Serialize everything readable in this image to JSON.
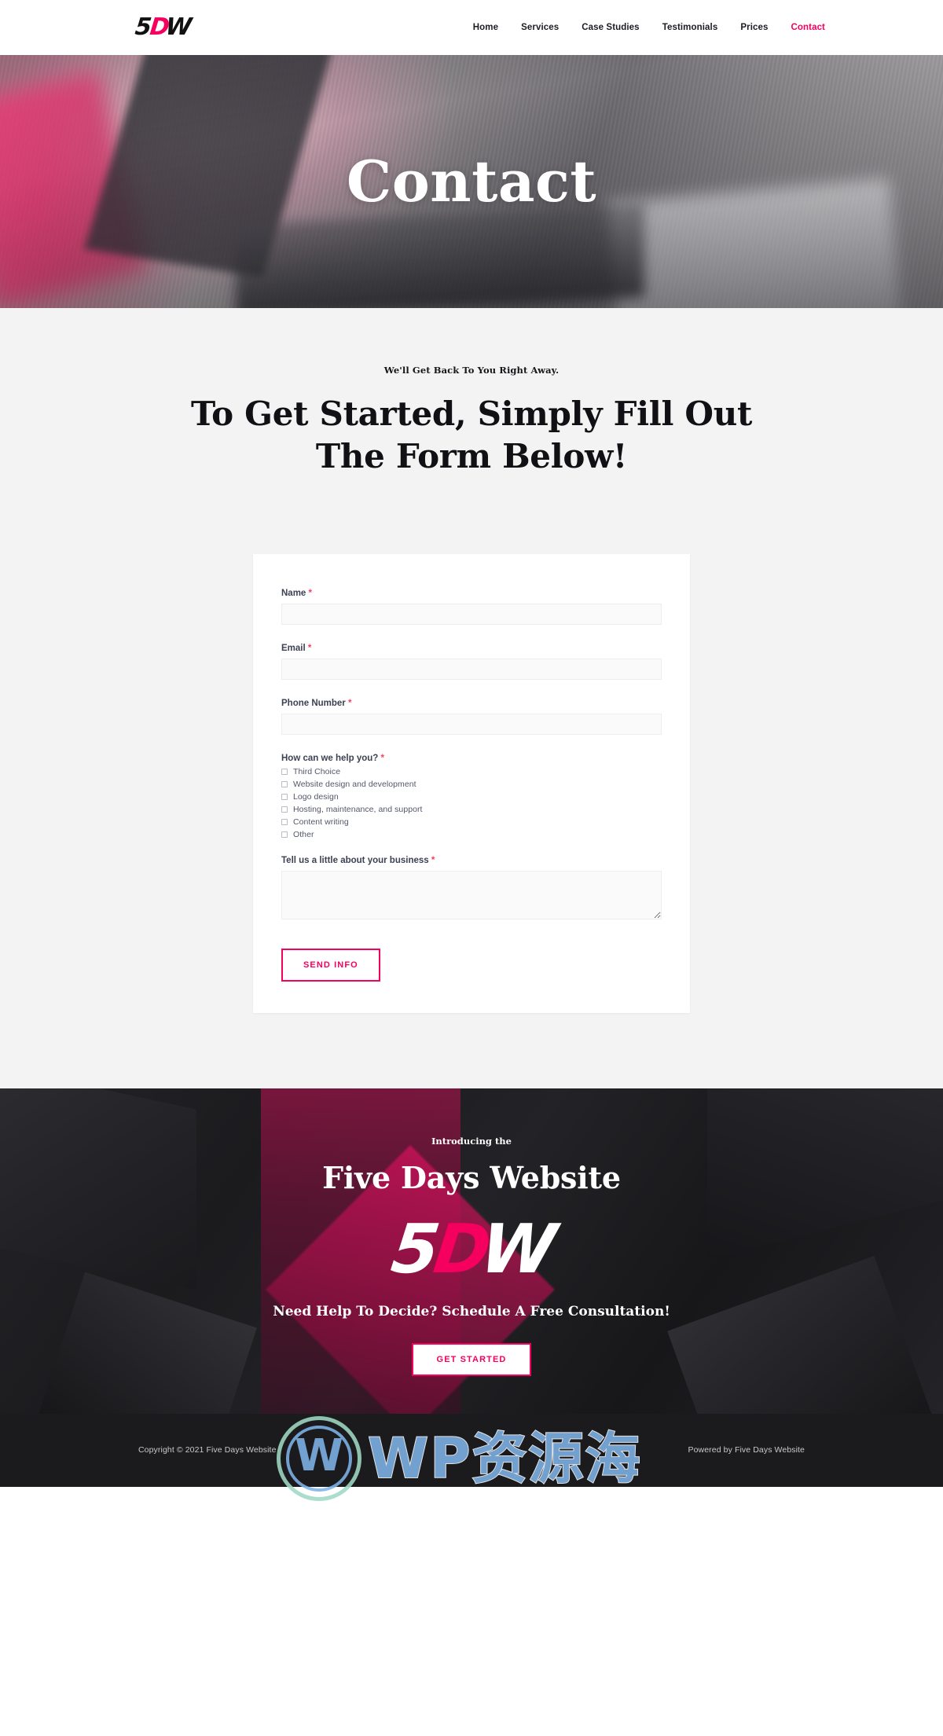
{
  "header": {
    "logo": {
      "part1": "5",
      "part2": "D",
      "part3": "W"
    },
    "nav": [
      {
        "label": "Home",
        "active": false
      },
      {
        "label": "Services",
        "active": false
      },
      {
        "label": "Case Studies",
        "active": false
      },
      {
        "label": "Testimonials",
        "active": false
      },
      {
        "label": "Prices",
        "active": false
      },
      {
        "label": "Contact",
        "active": true
      }
    ]
  },
  "hero": {
    "title": "Contact"
  },
  "form_section": {
    "eyebrow": "We'll Get Back To You Right Away.",
    "heading": "To Get Started, Simply Fill Out The Form Below!",
    "fields": {
      "name": {
        "label": "Name",
        "required": "*",
        "value": "",
        "placeholder": ""
      },
      "email": {
        "label": "Email",
        "required": "*",
        "value": "",
        "placeholder": ""
      },
      "phone": {
        "label": "Phone Number",
        "required": "*",
        "value": "",
        "placeholder": ""
      },
      "help": {
        "label": "How can we help you?",
        "required": "*",
        "options": [
          "Third Choice",
          "Website design and development",
          "Logo design",
          "Hosting, maintenance, and support",
          "Content writing",
          "Other"
        ]
      },
      "business": {
        "label": "Tell us a little about your business",
        "required": "*",
        "value": "",
        "placeholder": ""
      }
    },
    "submit_label": "SEND INFO"
  },
  "cta": {
    "eyebrow": "Introducing the",
    "title": "Five Days Website",
    "logo": {
      "part1": "5",
      "part2": "D",
      "part3": "W"
    },
    "subtitle": "Need Help To Decide? Schedule A Free Consultation!",
    "button_label": "GET STARTED"
  },
  "footer": {
    "copyright": "Copyright © 2021 Five Days Website",
    "powered_by": "Powered by Five Days Website"
  },
  "watermark": {
    "mark": "W",
    "text": "WP资源海"
  },
  "colors": {
    "accent_pink": "#f5005e",
    "dark_bg": "#1d1d20",
    "light_bg": "#f3f3f3",
    "text_dark": "#1c1c24",
    "required_red": "#f0415f"
  }
}
